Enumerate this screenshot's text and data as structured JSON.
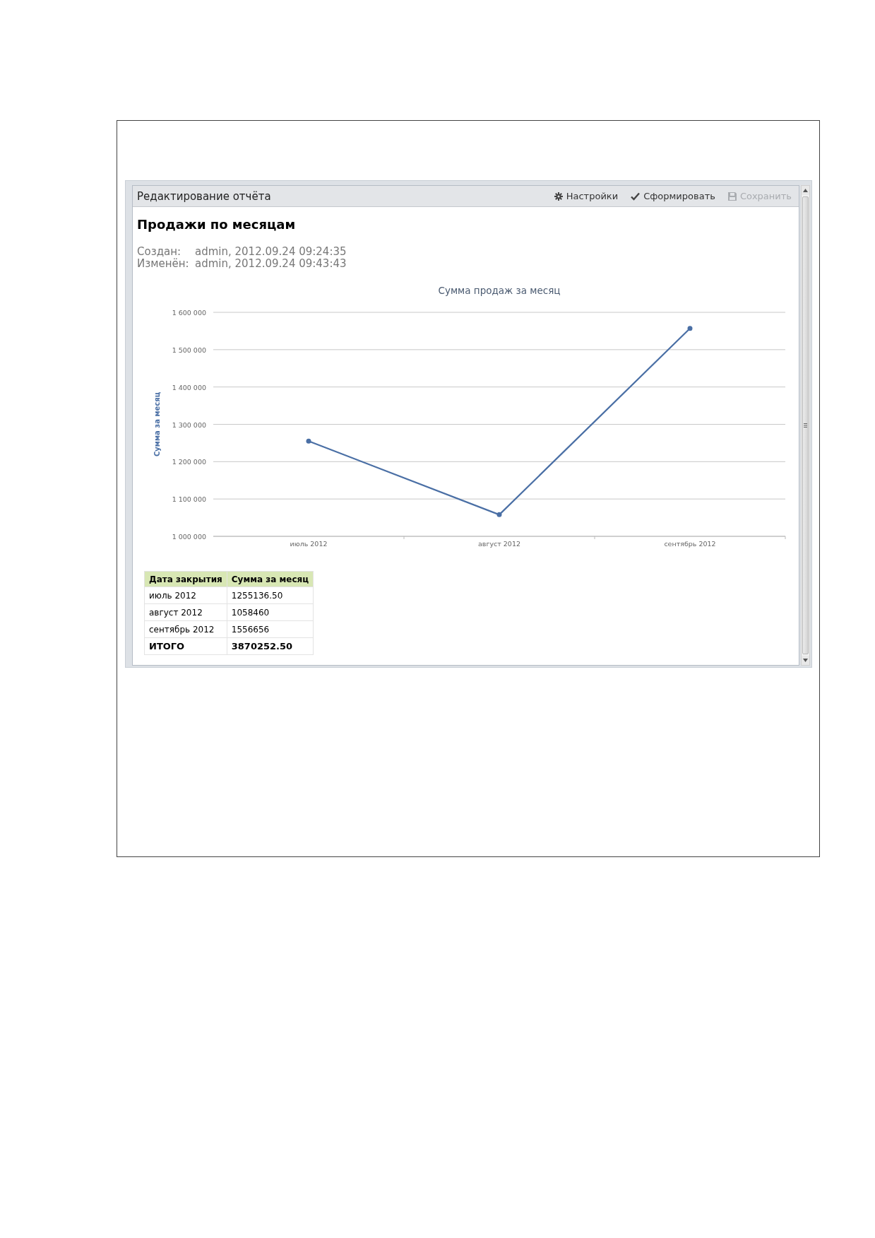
{
  "panel": {
    "title": "Редактирование отчёта",
    "toolbar": [
      {
        "kind": "gear",
        "label": "Настройки",
        "disabled": false
      },
      {
        "kind": "check",
        "label": "Сформировать",
        "disabled": false
      },
      {
        "kind": "save",
        "label": "Сохранить",
        "disabled": true
      }
    ]
  },
  "report": {
    "title": "Продажи по месяцам",
    "meta": [
      {
        "label": "Создан:",
        "value": "admin, 2012.09.24 09:24:35"
      },
      {
        "label": "Изменён:",
        "value": "admin, 2012.09.24 09:43:43"
      }
    ],
    "chart_data": {
      "type": "line",
      "title": "Сумма продаж за месяц",
      "ylabel": "Сумма за месяц",
      "categories": [
        "июль 2012",
        "август 2012",
        "сентябрь 2012"
      ],
      "grid": true,
      "series": [
        {
          "color": "#4a6fa5",
          "marker": true,
          "values": [
            1255000,
            1058000,
            1557000
          ]
        }
      ],
      "ylim": [
        1000000,
        1600000
      ],
      "yticks": [
        {
          "value": 1000000,
          "label": "1 000 000"
        },
        {
          "value": 1100000,
          "label": "1 100 000"
        },
        {
          "value": 1200000,
          "label": "1 200 000"
        },
        {
          "value": 1300000,
          "label": "1 300 000"
        },
        {
          "value": 1400000,
          "label": "1 400 000"
        },
        {
          "value": 1500000,
          "label": "1 500 000"
        },
        {
          "value": 1600000,
          "label": "1 600 000"
        }
      ]
    },
    "table": {
      "columns": [
        "Дата закрытия",
        "Сумма за месяц"
      ],
      "rows": [
        [
          "июль 2012",
          "1255136.50"
        ],
        [
          "август 2012",
          "1058460"
        ],
        [
          "сентябрь 2012",
          "1556656"
        ]
      ],
      "total": [
        "ИТОГО",
        "3870252.50"
      ]
    }
  }
}
